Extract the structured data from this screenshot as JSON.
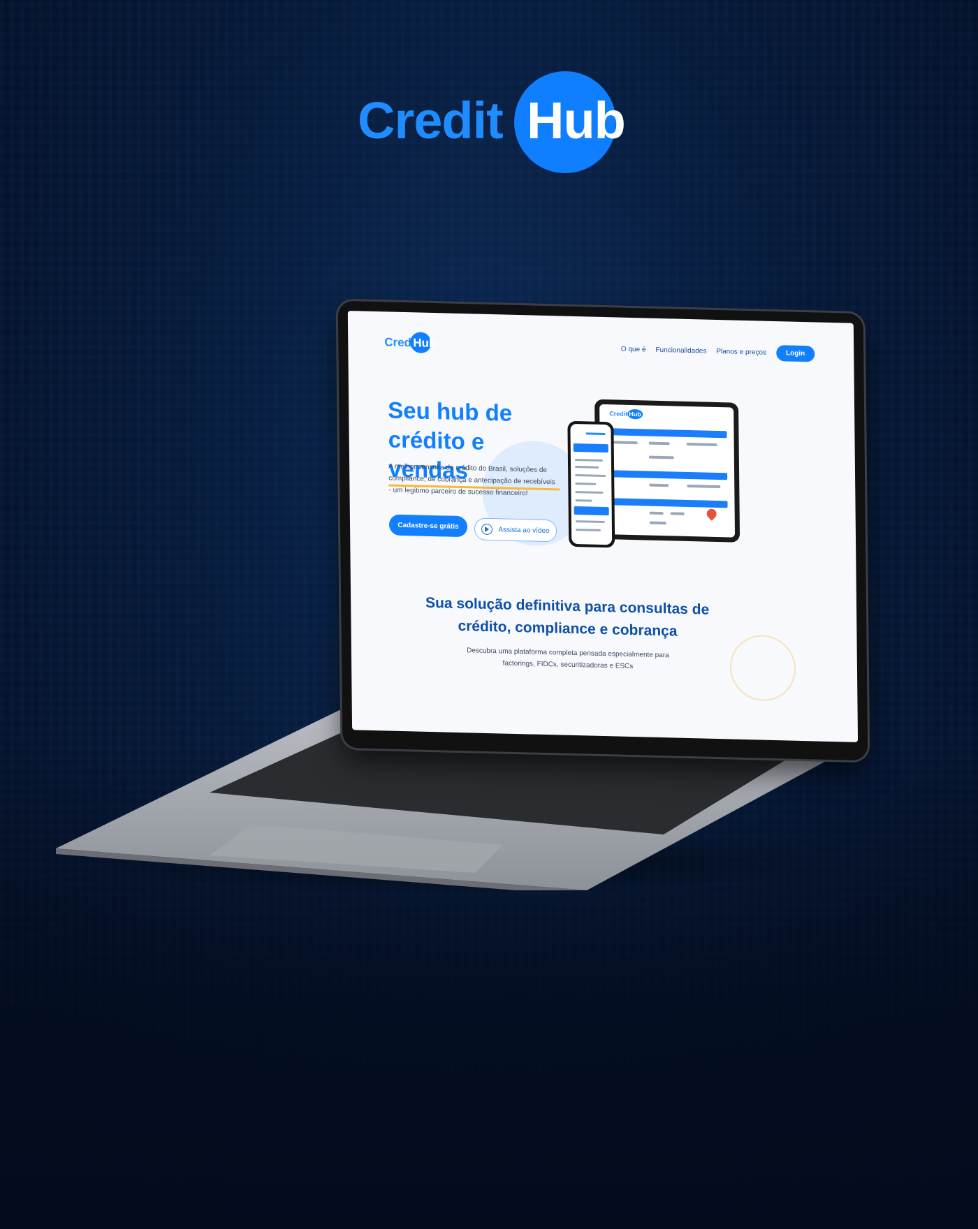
{
  "brand": {
    "word": "Credit",
    "hub": "Hub"
  },
  "site": {
    "logo_word": "Credit",
    "logo_hub": "Hub",
    "nav": {
      "item1": "O que é",
      "item2": "Funcionalidades",
      "item3": "Planos e preços",
      "login": "Login"
    },
    "hero": {
      "title_line1": "Seu hub de",
      "title_line2": "crédito e vendas",
      "subtitle": "A melhor consulta de crédito do Brasil, soluções de compliance, de cobrança e antecipação de recebíveis - um legítimo parceiro de sucesso financeiro!",
      "cta_primary": "Cadastre-se grátis",
      "cta_video": "Assista ao vídeo"
    },
    "section": {
      "title": "Sua solução definitiva para consultas de crédito, compliance e cobrança",
      "subtitle": "Descubra uma plataforma completa pensada especialmente para factorings, FIDCs, securitizadoras e ESCs"
    }
  },
  "colors": {
    "accent": "#127fff",
    "background": "#071a38",
    "highlight": "#f5b933"
  }
}
